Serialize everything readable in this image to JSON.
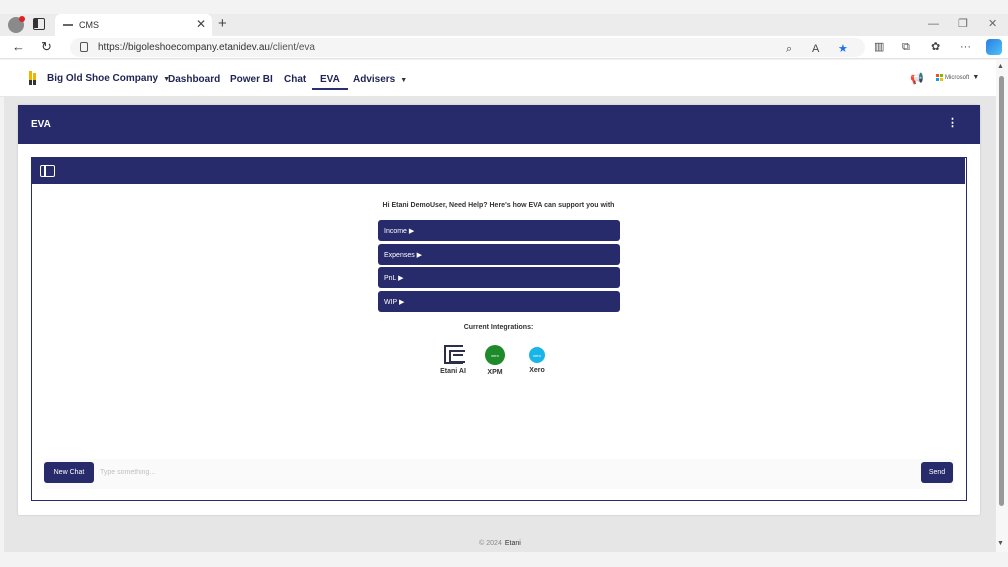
{
  "browser": {
    "tab_title": "CMS",
    "tab_close": "✕",
    "new_tab": "+",
    "url_host": "https://bigoleshoecompany.etanidev.au",
    "url_path": "/client/eva"
  },
  "navbar": {
    "company": "Big Old Shoe Company",
    "links": [
      "Dashboard",
      "Power BI",
      "Chat",
      "EVA",
      "Advisers"
    ],
    "active": "EVA",
    "account_label": "Microsoft"
  },
  "card": {
    "title": "EVA"
  },
  "chat": {
    "greeting": "Hi Etani DemoUser, Need Help? Here's how EVA can support you with",
    "options": [
      "Income ▶",
      "Expenses ▶",
      "PnL ▶",
      "WIP ▶"
    ],
    "integrations_title": "Current Integrations:",
    "integrations": [
      {
        "label": "Etani AI",
        "icon": "etani-icon"
      },
      {
        "label": "XPM",
        "icon": "xpm-icon",
        "badge": "xero"
      },
      {
        "label": "Xero",
        "icon": "xero-icon",
        "badge": "xero"
      }
    ],
    "new_chat": "New Chat",
    "input_placeholder": "Type something...",
    "send": "Send"
  },
  "footer": {
    "copyright": "© 2024",
    "brand": "Etani"
  },
  "colors": {
    "primary": "#272b6b",
    "xpm": "#1e8a2a",
    "xero": "#19b5e8"
  }
}
